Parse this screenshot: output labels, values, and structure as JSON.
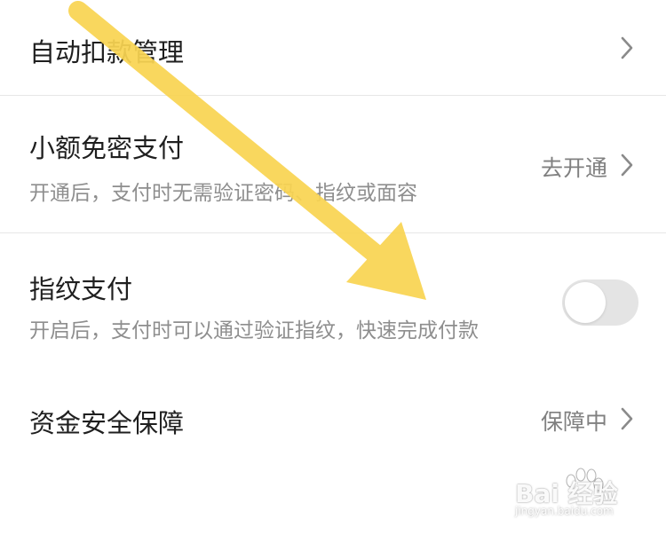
{
  "settings": {
    "items": [
      {
        "title": "自动扣款管理",
        "subtitle": "",
        "right_text": "",
        "control": "chevron-right-icon"
      },
      {
        "title": "小额免密支付",
        "subtitle": "开通后，支付时无需验证密码、指纹或面容",
        "right_text": "去开通",
        "control": "chevron-right-icon"
      },
      {
        "title": "指纹支付",
        "subtitle": "开启后，支付时可以通过验证指纹，快速完成付款",
        "right_text": "",
        "control": "toggle",
        "toggle_on": false
      },
      {
        "title": "资金安全保障",
        "subtitle": "",
        "right_text": "保障中",
        "control": "chevron-right-icon"
      }
    ]
  },
  "watermark": {
    "brand": "Bai 经验",
    "url": "jingyan.baidu.com"
  },
  "colors": {
    "arrow": "#F9D452",
    "title_text": "#1F1F1F",
    "subtitle_text": "#8E8E8E",
    "toggle_off_track": "#E4E4E4",
    "divider": "#E6E6E6"
  }
}
